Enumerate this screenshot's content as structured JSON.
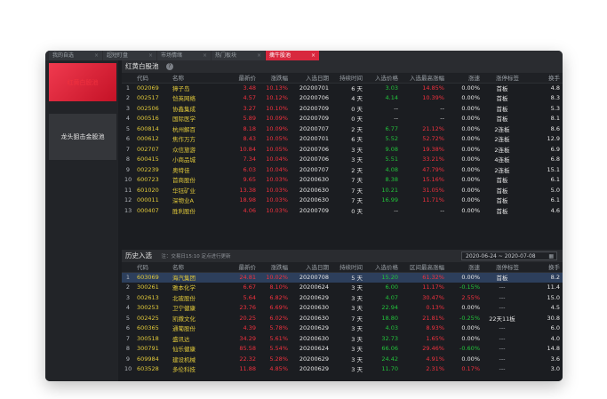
{
  "tabs": [
    {
      "label": "我的自选",
      "active": false
    },
    {
      "label": "超短盯盘",
      "active": false
    },
    {
      "label": "市场情绪",
      "active": false
    },
    {
      "label": "热门板块",
      "active": false
    },
    {
      "label": "擒牛股池",
      "active": true
    }
  ],
  "sidebar": {
    "items": [
      {
        "label": "红黄白股池",
        "active": true
      },
      {
        "label": "龙头狙击金股池",
        "active": false
      }
    ]
  },
  "panel1": {
    "title": "红黄白股池",
    "columns": [
      "",
      "代码",
      "名称",
      "最新价",
      "涨跌幅",
      "入选日期",
      "持续时间",
      "入选价格",
      "入选最高涨幅",
      "涨速",
      "涨停标签",
      "换手"
    ],
    "rows": [
      {
        "n": "1",
        "code": "002069",
        "name": "獐子岛",
        "price": "3.48",
        "chg": "10.13%",
        "date": "20200701",
        "dur": "6 天",
        "inprice": "3.03",
        "maxchg": "14.85%",
        "speed": "0.00%",
        "tag": "首板",
        "turn": "4.8"
      },
      {
        "n": "2",
        "code": "002517",
        "name": "恺英网络",
        "price": "4.57",
        "chg": "10.12%",
        "date": "20200706",
        "dur": "4 天",
        "inprice": "4.14",
        "maxchg": "10.39%",
        "speed": "0.00%",
        "tag": "首板",
        "turn": "8.3"
      },
      {
        "n": "3",
        "code": "002506",
        "name": "协鑫集成",
        "price": "3.27",
        "chg": "10.10%",
        "date": "20200709",
        "dur": "0 天",
        "inprice": "--",
        "maxchg": "--",
        "speed": "0.00%",
        "tag": "首板",
        "turn": "5.3"
      },
      {
        "n": "4",
        "code": "000516",
        "name": "国际医学",
        "price": "5.89",
        "chg": "10.09%",
        "date": "20200709",
        "dur": "0 天",
        "inprice": "--",
        "maxchg": "--",
        "speed": "0.00%",
        "tag": "首板",
        "turn": "8.1"
      },
      {
        "n": "5",
        "code": "600814",
        "name": "杭州解百",
        "price": "8.18",
        "chg": "10.09%",
        "date": "20200707",
        "dur": "2 天",
        "inprice": "6.77",
        "maxchg": "21.12%",
        "speed": "0.00%",
        "tag": "2连板",
        "turn": "8.6"
      },
      {
        "n": "6",
        "code": "000612",
        "name": "焦作万方",
        "price": "8.43",
        "chg": "10.05%",
        "date": "20200701",
        "dur": "6 天",
        "inprice": "5.52",
        "maxchg": "52.72%",
        "speed": "0.00%",
        "tag": "2连板",
        "turn": "12.9"
      },
      {
        "n": "7",
        "code": "002707",
        "name": "众信旅游",
        "price": "10.84",
        "chg": "10.05%",
        "date": "20200706",
        "dur": "3 天",
        "inprice": "9.08",
        "maxchg": "19.38%",
        "speed": "0.00%",
        "tag": "2连板",
        "turn": "6.9"
      },
      {
        "n": "8",
        "code": "600415",
        "name": "小商品城",
        "price": "7.34",
        "chg": "10.04%",
        "date": "20200706",
        "dur": "3 天",
        "inprice": "5.51",
        "maxchg": "33.21%",
        "speed": "0.00%",
        "tag": "4连板",
        "turn": "6.8"
      },
      {
        "n": "9",
        "code": "002239",
        "name": "奥特佳",
        "price": "6.03",
        "chg": "10.04%",
        "date": "20200707",
        "dur": "2 天",
        "inprice": "4.08",
        "maxchg": "47.79%",
        "speed": "0.00%",
        "tag": "2连板",
        "turn": "15.1"
      },
      {
        "n": "10",
        "code": "600723",
        "name": "首商股份",
        "price": "9.65",
        "chg": "10.03%",
        "date": "20200630",
        "dur": "7 天",
        "inprice": "8.38",
        "maxchg": "15.16%",
        "speed": "0.00%",
        "tag": "首板",
        "turn": "6.1"
      },
      {
        "n": "11",
        "code": "601020",
        "name": "华钰矿业",
        "price": "13.38",
        "chg": "10.03%",
        "date": "20200630",
        "dur": "7 天",
        "inprice": "10.21",
        "maxchg": "31.05%",
        "speed": "0.00%",
        "tag": "首板",
        "turn": "5.0"
      },
      {
        "n": "12",
        "code": "000011",
        "name": "深物业A",
        "price": "18.98",
        "chg": "10.03%",
        "date": "20200630",
        "dur": "7 天",
        "inprice": "16.99",
        "maxchg": "11.71%",
        "speed": "0.00%",
        "tag": "首板",
        "turn": "6.1"
      },
      {
        "n": "13",
        "code": "000407",
        "name": "胜利股份",
        "price": "4.06",
        "chg": "10.03%",
        "date": "20200709",
        "dur": "0 天",
        "inprice": "--",
        "maxchg": "--",
        "speed": "0.00%",
        "tag": "首板",
        "turn": "4.6"
      }
    ]
  },
  "panel2": {
    "title": "历史入选",
    "note": "注：交易日15:10 定点进行更新",
    "daterange": "2020-06-24 ~ 2020-07-08",
    "columns": [
      "",
      "代码",
      "名称",
      "最新价",
      "涨跌幅",
      "入选日期",
      "持续时间",
      "入选价格",
      "区间最高涨幅",
      "涨速",
      "涨停标签",
      "换手"
    ],
    "rows": [
      {
        "n": "1",
        "code": "603069",
        "name": "海汽集团",
        "price": "24.81",
        "chg": "10.02%",
        "date": "20200708",
        "dur": "5 天",
        "inprice": "15.20",
        "maxchg": "61.32%",
        "speed": "0.00%",
        "tag": "首板",
        "turn": "8.2",
        "sel": true
      },
      {
        "n": "2",
        "code": "300261",
        "name": "雅本化学",
        "price": "6.67",
        "chg": "8.10%",
        "date": "20200624",
        "dur": "3 天",
        "inprice": "6.00",
        "maxchg": "11.17%",
        "speed": "-0.15%",
        "tag": "---",
        "turn": "11.4"
      },
      {
        "n": "3",
        "code": "002613",
        "name": "北玻股份",
        "price": "5.64",
        "chg": "6.82%",
        "date": "20200629",
        "dur": "3 天",
        "inprice": "4.07",
        "maxchg": "30.47%",
        "speed": "2.55%",
        "tag": "---",
        "turn": "15.0"
      },
      {
        "n": "4",
        "code": "300253",
        "name": "卫宁健康",
        "price": "23.76",
        "chg": "6.69%",
        "date": "20200630",
        "dur": "3 天",
        "inprice": "22.94",
        "maxchg": "0.13%",
        "speed": "0.00%",
        "tag": "---",
        "turn": "4.5"
      },
      {
        "n": "5",
        "code": "002425",
        "name": "凯撒文化",
        "price": "20.25",
        "chg": "6.02%",
        "date": "20200630",
        "dur": "7 天",
        "inprice": "18.80",
        "maxchg": "21.81%",
        "speed": "-0.25%",
        "tag": "22天11板",
        "turn": "30.8"
      },
      {
        "n": "6",
        "code": "600365",
        "name": "通葡股份",
        "price": "4.39",
        "chg": "5.78%",
        "date": "20200629",
        "dur": "3 天",
        "inprice": "4.03",
        "maxchg": "8.93%",
        "speed": "0.00%",
        "tag": "---",
        "turn": "6.0"
      },
      {
        "n": "7",
        "code": "300518",
        "name": "盛讯达",
        "price": "34.29",
        "chg": "5.61%",
        "date": "20200630",
        "dur": "3 天",
        "inprice": "32.73",
        "maxchg": "1.65%",
        "speed": "0.00%",
        "tag": "---",
        "turn": "4.0"
      },
      {
        "n": "8",
        "code": "300791",
        "name": "仙乐健康",
        "price": "85.58",
        "chg": "5.54%",
        "date": "20200624",
        "dur": "3 天",
        "inprice": "66.06",
        "maxchg": "29.46%",
        "speed": "-0.60%",
        "tag": "---",
        "turn": "14.8"
      },
      {
        "n": "9",
        "code": "609984",
        "name": "建设机械",
        "price": "22.32",
        "chg": "5.28%",
        "date": "20200629",
        "dur": "3 天",
        "inprice": "24.42",
        "maxchg": "4.91%",
        "speed": "0.00%",
        "tag": "---",
        "turn": "3.6"
      },
      {
        "n": "10",
        "code": "603528",
        "name": "多伦科技",
        "price": "11.88",
        "chg": "4.85%",
        "date": "20200629",
        "dur": "3 天",
        "inprice": "11.70",
        "maxchg": "2.31%",
        "speed": "0.17%",
        "tag": "---",
        "turn": "3.0"
      }
    ]
  }
}
